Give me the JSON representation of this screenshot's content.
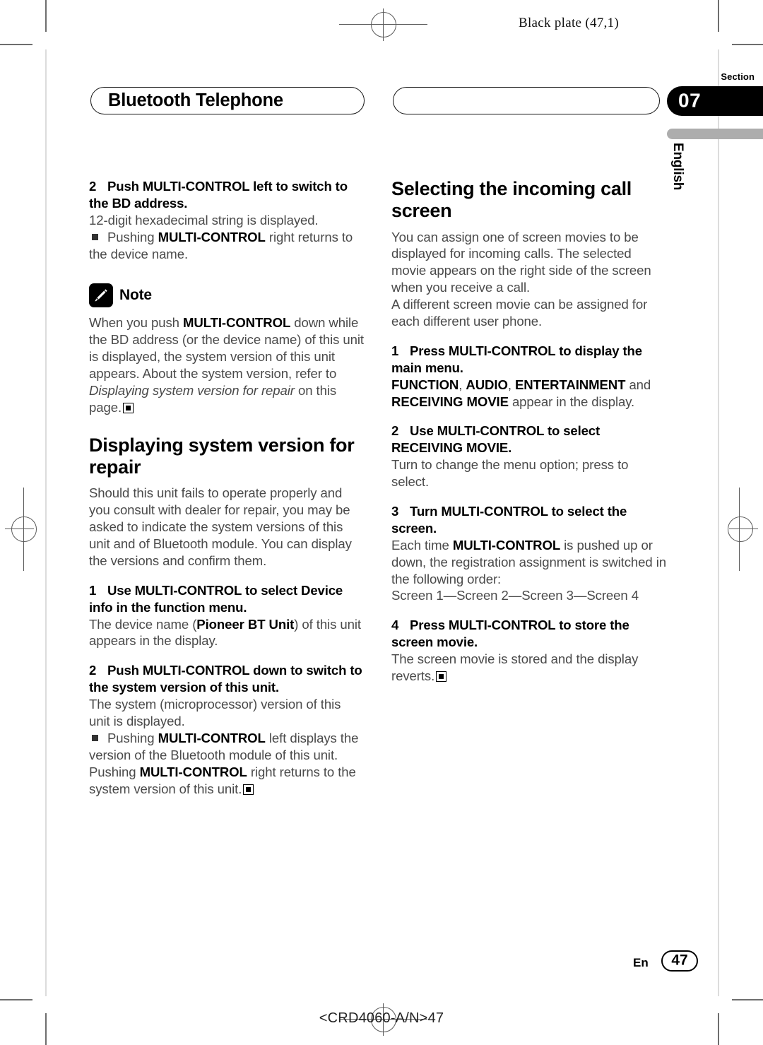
{
  "page": {
    "plate_note": "Black plate (47,1)",
    "section_label": "Section",
    "section_number": "07",
    "language_tab": "English",
    "running_head_left": "Bluetooth Telephone",
    "running_head_right": "",
    "footer_lang": "En",
    "footer_page": "47",
    "footer_code": "<CRD4060-A/N>47"
  },
  "left_column": {
    "step2_heading_num": "2",
    "step2_heading": "Push MULTI-CONTROL left to switch to the BD address.",
    "step2_body": "12-digit hexadecimal string is displayed.",
    "step2_bullet_1": "Pushing ",
    "step2_bullet_1_bold": "MULTI-CONTROL",
    "step2_bullet_1_end": " right returns to the device name.",
    "note_label": "Note",
    "note_icon": "pencil-icon",
    "note_text_a": "When you push ",
    "note_text_bold": "MULTI-CONTROL",
    "note_text_b": " down while the BD address (or the device name) of this unit is displayed, the system version of this unit appears. About the system version, refer to ",
    "note_text_italic": "Displaying system version for repair",
    "note_text_c": " on this page.",
    "heading2": "Displaying system version for repair",
    "intro": "Should this unit fails to operate properly and you consult with dealer for repair, you may be asked to indicate the system versions of this unit and of Bluetooth module. You can display the versions and confirm them.",
    "step1_num": "1",
    "step1_heading": "Use MULTI-CONTROL to select Device info in the function menu.",
    "step1_body_a": "The device name (",
    "step1_body_bold": "Pioneer BT Unit",
    "step1_body_b": ") of this unit appears in the display.",
    "step2b_num": "2",
    "step2b_heading": "Push MULTI-CONTROL down to switch to the system version of this unit.",
    "step2b_body": "The system (microprocessor) version of this unit is displayed.",
    "step2b_bullet_a": "Pushing ",
    "step2b_bullet_bold1": "MULTI-CONTROL",
    "step2b_bullet_b": " left displays the version of the Bluetooth module of this unit. Pushing ",
    "step2b_bullet_bold2": "MULTI-CONTROL",
    "step2b_bullet_c": " right returns to the system version of this unit."
  },
  "right_column": {
    "heading": "Selecting the incoming call screen",
    "intro_1": "You can assign one of screen movies to be displayed for incoming calls. The selected movie appears on the right side of the screen when you receive a call.",
    "intro_2": "A different screen movie can be assigned for each different user phone.",
    "step1_num": "1",
    "step1_heading": "Press MULTI-CONTROL to display the main menu.",
    "step1_body_bold1": "FUNCTION",
    "step1_body_sep1": ", ",
    "step1_body_bold2": "AUDIO",
    "step1_body_sep2": ", ",
    "step1_body_bold3": "ENTERTAINMENT",
    "step1_body_mid": " and ",
    "step1_body_bold4": "RECEIVING MOVIE",
    "step1_body_end": " appear in the display.",
    "step2_num": "2",
    "step2_heading": "Use MULTI-CONTROL to select RECEIVING MOVIE.",
    "step2_body": "Turn to change the menu option; press to select.",
    "step3_num": "3",
    "step3_heading": "Turn MULTI-CONTROL to select the screen.",
    "step3_body_a": "Each time ",
    "step3_body_bold": "MULTI-CONTROL",
    "step3_body_b": " is pushed up or down, the registration assignment is switched in the following order:",
    "step3_order": "Screen 1—Screen 2—Screen 3—Screen 4",
    "step4_num": "4",
    "step4_heading": "Press MULTI-CONTROL to store the screen movie.",
    "step4_body": "The screen movie is stored and the display reverts."
  }
}
